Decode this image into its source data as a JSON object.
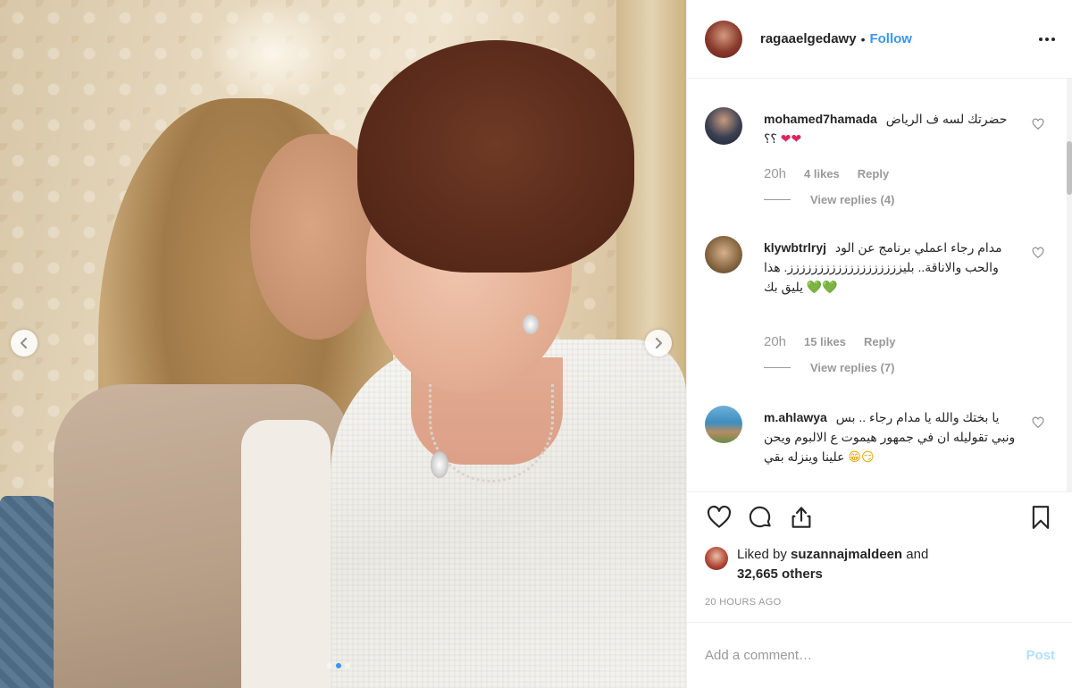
{
  "photo": {
    "alt_subject": "",
    "dots": [
      {
        "active": false
      },
      {
        "active": true
      },
      {
        "active": false
      }
    ]
  },
  "header": {
    "username": "ragaaelgedawy",
    "separator": "•",
    "follow_label": "Follow",
    "more_icon": "more-options-icon"
  },
  "comments": [
    {
      "username": "mohamed7hamada",
      "text": "حضرتك لسه ف الرياض ؟؟",
      "emojis": "❤❤",
      "time": "20h",
      "likes": "4 likes",
      "reply_label": "Reply",
      "view_replies": "View replies (4)"
    },
    {
      "username": "klywbtrlryj",
      "text": "مدام رجاء اعملي برنامج عن الود والحب والاناقة.. بليززززززززززززززززززز. هذا يليق بك",
      "emojis": "💚💚",
      "time": "20h",
      "likes": "15 likes",
      "reply_label": "Reply",
      "view_replies": "View replies (7)"
    },
    {
      "username": "m.ahlawya",
      "text": "يا بختك والله يا مدام رجاء .. بس ونبي تقوليله ان في جمهور هيموت ع الالبوم ويحن علينا وينزله بقي",
      "emojis": "😁😏",
      "time": "",
      "likes": "",
      "reply_label": "",
      "view_replies": ""
    }
  ],
  "actions": {
    "like_icon": "heart-outline-icon",
    "comment_icon": "comment-bubble-icon",
    "share_icon": "share-icon",
    "save_icon": "bookmark-icon"
  },
  "likes": {
    "prefix": "Liked by ",
    "liker": "suzannajmaldeen",
    "middle": " and",
    "count": "32,665 others"
  },
  "post_time": "20 HOURS AGO",
  "comment_box": {
    "placeholder": "Add a comment…",
    "post_label": "Post"
  },
  "colors": {
    "accent": "#3897f0",
    "post_disabled": "#b2dffc",
    "muted": "#999999",
    "text": "#262626"
  }
}
